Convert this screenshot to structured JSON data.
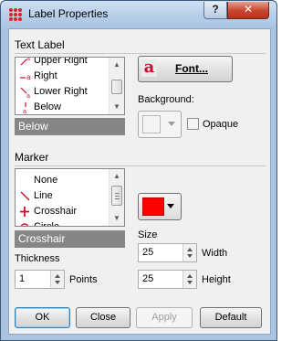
{
  "window": {
    "title": "Label Properties",
    "help_label": "?",
    "close_label": "✕"
  },
  "text_label": {
    "section_title": "Text Label",
    "positions": [
      {
        "label": "Upper Right",
        "icon": "upper-right-position-icon"
      },
      {
        "label": "Right",
        "icon": "right-position-icon"
      },
      {
        "label": "Lower Right",
        "icon": "lower-right-position-icon"
      },
      {
        "label": "Below",
        "icon": "below-position-icon"
      }
    ],
    "selected_position": "Below",
    "font_button_label": "Font...",
    "font_glyph": "a",
    "background_label": "Background:",
    "opaque_label": "Opaque",
    "opaque_checked": false,
    "background_color": "#f4f4f4"
  },
  "marker": {
    "section_title": "Marker",
    "types": [
      {
        "label": "None",
        "icon": "none-marker-icon"
      },
      {
        "label": "Line",
        "icon": "line-marker-icon"
      },
      {
        "label": "Crosshair",
        "icon": "crosshair-marker-icon"
      },
      {
        "label": "Circle",
        "icon": "circle-marker-icon"
      }
    ],
    "selected_type": "Crosshair",
    "color": "#ff0000",
    "size_label": "Size",
    "width_value": "25",
    "width_label": "Width",
    "height_value": "25",
    "height_label": "Height",
    "thickness_label": "Thickness",
    "thickness_value": "1",
    "thickness_unit": "Points"
  },
  "buttons": {
    "ok": "OK",
    "close": "Close",
    "apply": "Apply",
    "default": "Default"
  },
  "colors": {
    "accent_red": "#cc0000",
    "selection_bar": "#868686"
  }
}
